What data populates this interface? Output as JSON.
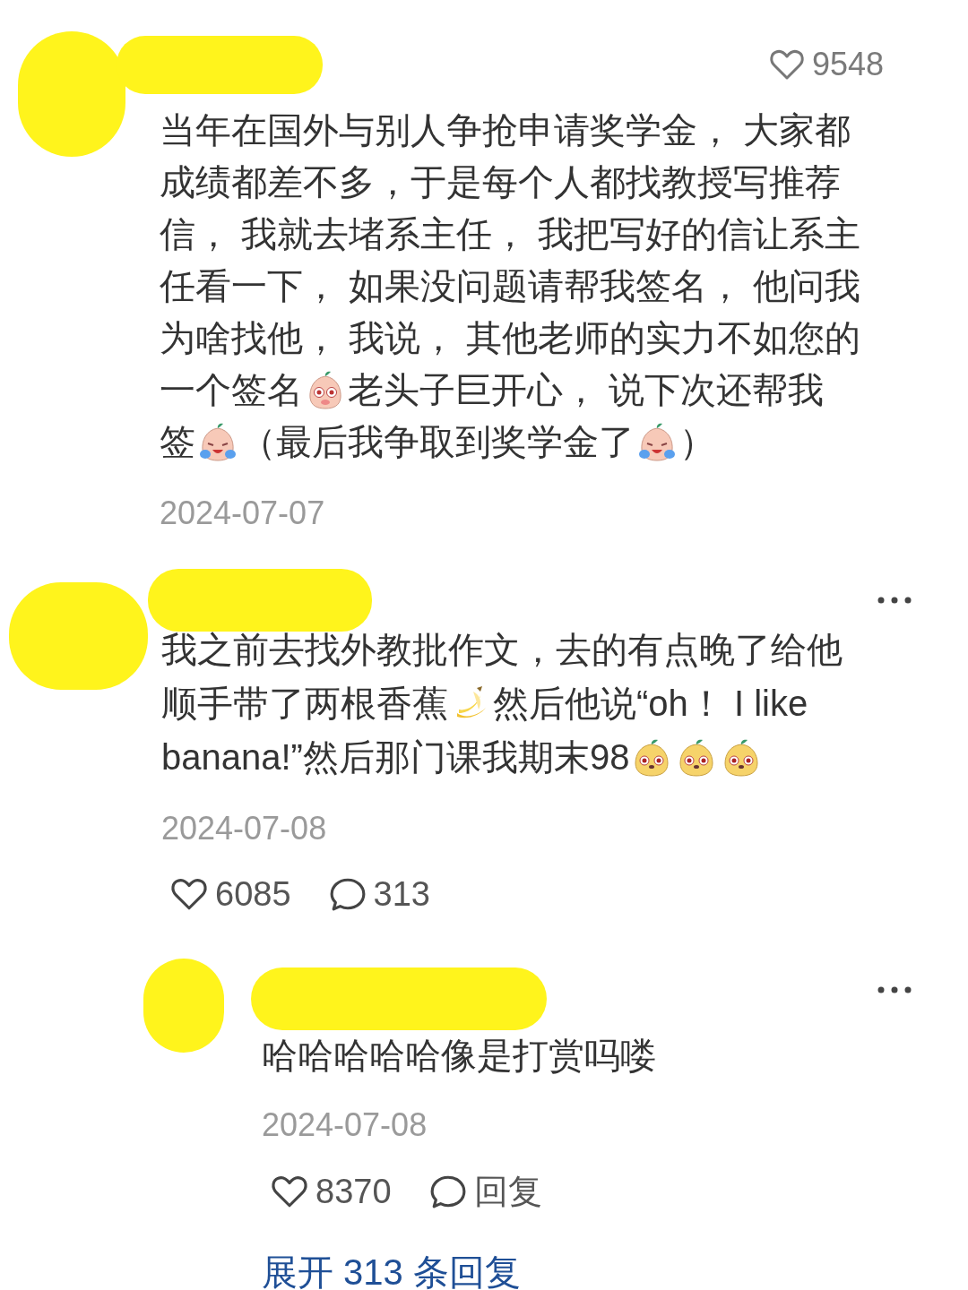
{
  "comments": [
    {
      "has_menu": false,
      "header_likes": "9548",
      "lines": [
        [
          {
            "kind": "text",
            "text": "当年在国外与别人争抢申请奖学金， 大家都"
          }
        ],
        [
          {
            "kind": "text",
            "text": "成绩都差不多，于是每个人都找教授写推荐"
          }
        ],
        [
          {
            "kind": "text",
            "text": "信， 我就去堵系主任， 我把写好的信让系主"
          }
        ],
        [
          {
            "kind": "text",
            "text": "任看一下， 如果没问题请帮我签名， 他问我"
          }
        ],
        [
          {
            "kind": "text",
            "text": "为啥找他， 我说， 其他老师的实力不如您的"
          }
        ],
        [
          {
            "kind": "text",
            "text": "一个签名"
          },
          {
            "kind": "peach"
          },
          {
            "kind": "text",
            "text": " 老头子巨开心， 说下次还帮我"
          }
        ],
        [
          {
            "kind": "text",
            "text": "签"
          },
          {
            "kind": "crying"
          },
          {
            "kind": "text",
            "text": " （最后我争取到奖学金了"
          },
          {
            "kind": "crying"
          },
          {
            "kind": "text",
            "text": "）"
          }
        ]
      ],
      "date": "2024-07-07"
    },
    {
      "has_menu": true,
      "lines": [
        [
          {
            "kind": "text",
            "text": "我之前去找外教批作文，去的有点晚了给他"
          }
        ],
        [
          {
            "kind": "text",
            "text": "顺手带了两根香蕉"
          },
          {
            "kind": "banana"
          },
          {
            "kind": "text",
            "text": "然后他说“oh！ I like"
          }
        ],
        [
          {
            "kind": "text",
            "text": "banana!”然后那门课我期末98"
          },
          {
            "kind": "dog"
          },
          {
            "kind": "dog"
          },
          {
            "kind": "dog"
          }
        ]
      ],
      "date": "2024-07-08",
      "likes": "6085",
      "comments": "313",
      "replies": [
        {
          "has_menu": true,
          "lines": [
            [
              {
                "kind": "text",
                "text": "哈哈哈哈哈像是打赏吗喽"
              }
            ]
          ],
          "date": "2024-07-08",
          "likes": "8370",
          "reply_label": "回复"
        }
      ],
      "expand_label": "展开 313 条回复"
    }
  ]
}
